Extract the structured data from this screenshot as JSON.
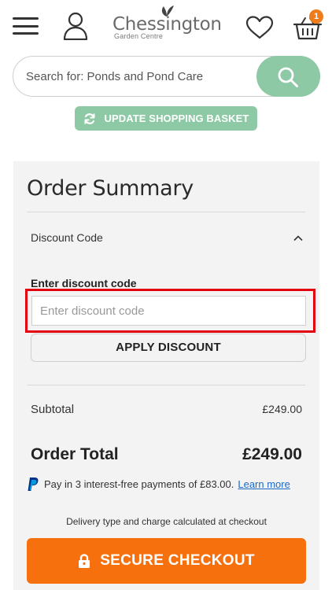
{
  "header": {
    "logo_name": "Chessington",
    "logo_sub": "Garden Centre",
    "basket_count": "1",
    "icons": [
      "menu-icon",
      "user-icon",
      "leaf-icon",
      "heart-icon",
      "basket-icon"
    ]
  },
  "search": {
    "placeholder": "Search for: Ponds and Pond Care",
    "button_icon": "search-icon"
  },
  "update_basket": {
    "label": "UPDATE SHOPPING BASKET",
    "icon": "refresh-icon"
  },
  "summary": {
    "title": "Order Summary",
    "discount_section_label": "Discount Code",
    "discount_input_label": "Enter discount code",
    "discount_input_placeholder": "Enter discount code",
    "apply_label": "APPLY DISCOUNT",
    "subtotal_label": "Subtotal",
    "subtotal_value": "£249.00",
    "total_label": "Order Total",
    "total_value": "£249.00",
    "paypal_text": "Pay in 3 interest-free payments of £83.00.",
    "paypal_link": "Learn more",
    "delivery_note": "Delivery type and charge calculated at checkout",
    "checkout_label": "SECURE CHECKOUT"
  },
  "colors": {
    "accent_green": "#8ec9a6",
    "checkout_orange": "#f7700e",
    "highlight_red": "#e5000d",
    "badge_orange": "#ef7c1b",
    "link_blue": "#1b6ac6"
  }
}
